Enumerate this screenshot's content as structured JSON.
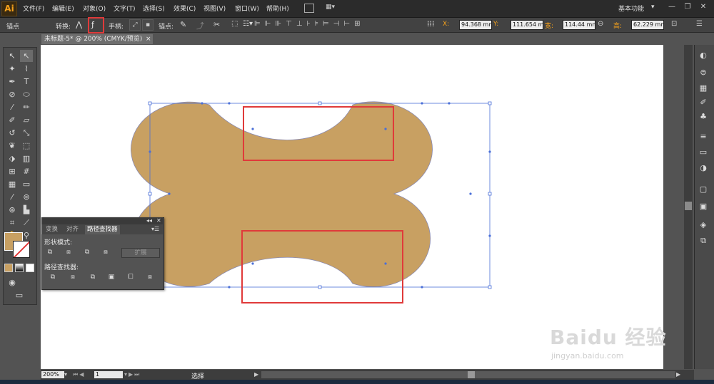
{
  "app": {
    "logo": "Ai",
    "workspace": "基本功能"
  },
  "menu": [
    "文件(F)",
    "编辑(E)",
    "对象(O)",
    "文字(T)",
    "选择(S)",
    "效果(C)",
    "视图(V)",
    "窗口(W)",
    "帮助(H)"
  ],
  "control": {
    "mode_label": "锚点",
    "convert_label": "转换:",
    "handle_label": "手柄:",
    "anchor_label": "锚点:",
    "x_label": "X:",
    "x_value": "94.368 mm",
    "y_label": "Y:",
    "y_value": "111.654 mm",
    "w_label": "宽:",
    "w_value": "114.44 mm",
    "h_label": "高:",
    "h_value": "62.229 mm"
  },
  "document": {
    "tab": "未标题-5* @ 200% (CMYK/预览)",
    "close": "×"
  },
  "status": {
    "zoom": "200%",
    "page": "1",
    "tool": "选择"
  },
  "pathfinder": {
    "tabs": [
      "变换",
      "对齐",
      "路径查找器"
    ],
    "shape_modes_label": "形状模式:",
    "expand_label": "扩展",
    "pathfinders_label": "路径查找器:"
  },
  "colors": {
    "bone_fill": "#C8A062",
    "highlight": "#E03A3A",
    "selection": "#4A6FD8"
  },
  "watermark": {
    "brand": "Baidu 经验",
    "url": "jingyan.baidu.com"
  }
}
